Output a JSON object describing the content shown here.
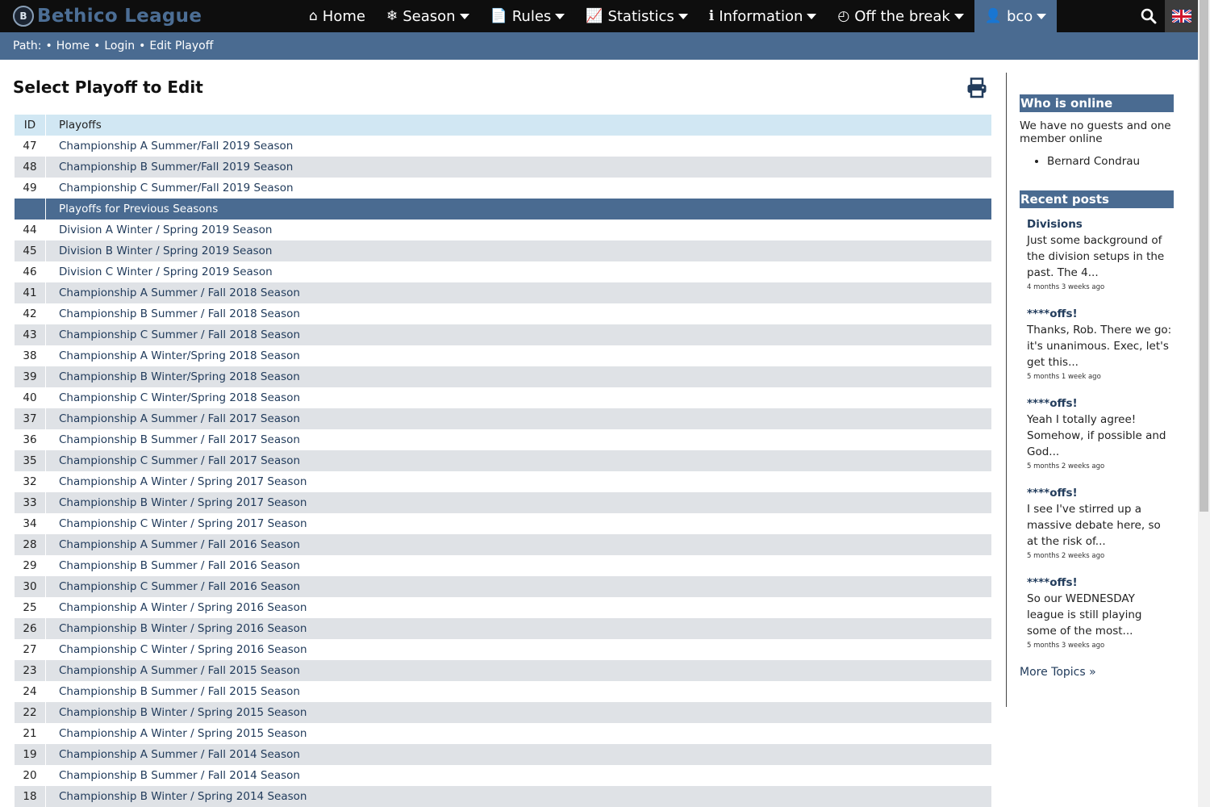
{
  "brand": {
    "logo_letter": "B",
    "name": "Bethico League"
  },
  "nav": [
    {
      "label": "Home",
      "icon": "⌂",
      "caret": false,
      "active": false
    },
    {
      "label": "Season",
      "icon": "❄",
      "caret": true,
      "active": false
    },
    {
      "label": "Rules",
      "icon": "📄",
      "caret": true,
      "active": false
    },
    {
      "label": "Statistics",
      "icon": "📈",
      "caret": true,
      "active": false
    },
    {
      "label": "Information",
      "icon": "ℹ",
      "caret": true,
      "active": false
    },
    {
      "label": "Off the break",
      "icon": "◴",
      "caret": true,
      "active": false
    },
    {
      "label": "bco",
      "icon": "👤",
      "caret": true,
      "active": true
    }
  ],
  "path": {
    "label": "Path:",
    "items": [
      "Home",
      "Login",
      "Edit Playoff"
    ]
  },
  "page": {
    "title": "Select Playoff to Edit"
  },
  "table": {
    "headers": {
      "id": "ID",
      "name": "Playoffs"
    },
    "current": [
      {
        "id": "47",
        "name": "Championship A Summer/Fall 2019 Season"
      },
      {
        "id": "48",
        "name": "Championship B Summer/Fall 2019 Season"
      },
      {
        "id": "49",
        "name": "Championship C Summer/Fall 2019 Season"
      }
    ],
    "previous_label": "Playoffs for Previous Seasons",
    "previous": [
      {
        "id": "44",
        "name": "Division A Winter / Spring 2019 Season"
      },
      {
        "id": "45",
        "name": "Division B Winter / Spring 2019 Season"
      },
      {
        "id": "46",
        "name": "Division C Winter / Spring 2019 Season"
      },
      {
        "id": "41",
        "name": "Championship A Summer / Fall 2018 Season"
      },
      {
        "id": "42",
        "name": "Championship B Summer / Fall 2018 Season"
      },
      {
        "id": "43",
        "name": "Championship C Summer / Fall 2018 Season"
      },
      {
        "id": "38",
        "name": "Championship A Winter/Spring 2018 Season"
      },
      {
        "id": "39",
        "name": "Championship B Winter/Spring 2018 Season"
      },
      {
        "id": "40",
        "name": "Championship C Winter/Spring 2018 Season"
      },
      {
        "id": "37",
        "name": "Championship A Summer / Fall 2017 Season"
      },
      {
        "id": "36",
        "name": "Championship B Summer / Fall 2017 Season"
      },
      {
        "id": "35",
        "name": "Championship C Summer / Fall 2017 Season"
      },
      {
        "id": "32",
        "name": "Championship A Winter / Spring 2017 Season"
      },
      {
        "id": "33",
        "name": "Championship B Winter / Spring 2017 Season"
      },
      {
        "id": "34",
        "name": "Championship C Winter / Spring 2017 Season"
      },
      {
        "id": "28",
        "name": "Championship A Summer / Fall 2016 Season"
      },
      {
        "id": "29",
        "name": "Championship B Summer / Fall 2016 Season"
      },
      {
        "id": "30",
        "name": "Championship C Summer / Fall 2016 Season"
      },
      {
        "id": "25",
        "name": "Championship A Winter / Spring 2016 Season"
      },
      {
        "id": "26",
        "name": "Championship B Winter / Spring 2016 Season"
      },
      {
        "id": "27",
        "name": "Championship C Winter / Spring 2016 Season"
      },
      {
        "id": "23",
        "name": "Championship A Summer / Fall 2015 Season"
      },
      {
        "id": "24",
        "name": "Championship B Summer / Fall 2015 Season"
      },
      {
        "id": "22",
        "name": "Championship B Winter / Spring 2015 Season"
      },
      {
        "id": "21",
        "name": "Championship A Winter / Spring 2015 Season"
      },
      {
        "id": "19",
        "name": "Championship A Summer / Fall 2014 Season"
      },
      {
        "id": "20",
        "name": "Championship B Summer / Fall 2014 Season"
      },
      {
        "id": "18",
        "name": "Championship B Winter / Spring 2014 Season"
      }
    ]
  },
  "sidebar": {
    "online": {
      "title": "Who is online",
      "text": "We have no guests and one member online",
      "members": [
        "Bernard Condrau"
      ]
    },
    "recent": {
      "title": "Recent posts",
      "posts": [
        {
          "title": "Divisions",
          "body": "Just some background of the division setups in the past. The 4...",
          "time": "4 months 3 weeks ago"
        },
        {
          "title": "****offs!",
          "body": "Thanks, Rob. There we go: it's unanimous. Exec, let's get this...",
          "time": "5 months 1 week ago"
        },
        {
          "title": "****offs!",
          "body": "Yeah I totally agree! Somehow, if possible and God...",
          "time": "5 months 2 weeks ago"
        },
        {
          "title": "****offs!",
          "body": "I see I've stirred up a massive debate here, so at the risk of...",
          "time": "5 months 2 weeks ago"
        },
        {
          "title": "****offs!",
          "body": "So our WEDNESDAY league is still playing some of the most...",
          "time": "5 months 3 weeks ago"
        }
      ],
      "more": "More Topics »"
    }
  },
  "icons": {
    "search": "search-icon",
    "flag": "uk-flag-icon",
    "print": "print-icon"
  },
  "colors": {
    "nav_bg": "#0e0e0e",
    "accent": "#4a6b91",
    "header_row": "#d1e7f3",
    "alt_row": "#dfe2e6",
    "link": "#223c5c"
  }
}
